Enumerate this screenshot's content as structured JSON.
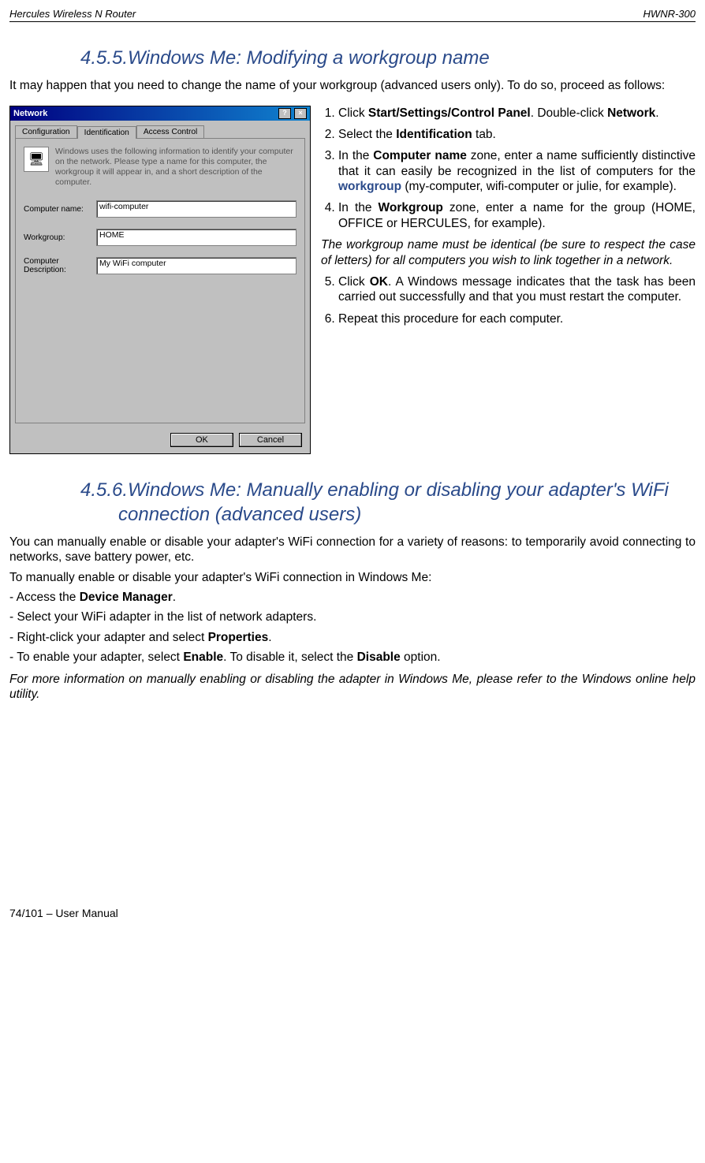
{
  "header": {
    "left": "Hercules Wireless N Router",
    "right": "HWNR-300"
  },
  "section455": {
    "heading": "4.5.5.Windows Me: Modifying a workgroup name",
    "intro": "It may happen that you need to change the name of your workgroup (advanced users only).  To do so, proceed as follows:"
  },
  "dialog": {
    "title": "Network",
    "tabs": {
      "config": "Configuration",
      "ident": "Identification",
      "access": "Access Control"
    },
    "desc": "Windows uses the following information to identify your computer on the network.  Please type a name for this computer, the workgroup it will appear in, and a short description of the computer.",
    "labels": {
      "comp_name": "Computer name:",
      "workgroup": "Workgroup:",
      "comp_desc": "Computer Description:"
    },
    "values": {
      "comp_name": "wifi-computer",
      "workgroup": "HOME",
      "comp_desc": "My WiFi computer"
    },
    "ok": "OK",
    "cancel": "Cancel",
    "help_q": "?",
    "close_x": "×"
  },
  "steps455": {
    "s1a": "Click ",
    "s1b": "Start/Settings/Control Panel",
    "s1c": ".  Double-click ",
    "s1d": "Network",
    "s1e": ".",
    "s2a": "Select the ",
    "s2b": "Identification",
    "s2c": " tab.",
    "s3a": "In the ",
    "s3b": "Computer name",
    "s3c": " zone, enter a name sufficiently distinctive that it can easily be recognized in the list of computers for the ",
    "s3d": "workgroup",
    "s3e": " (my-computer, wifi-computer or julie, for example).",
    "s4a": "In the ",
    "s4b": "Workgroup",
    "s4c": " zone, enter a name for the group (HOME, OFFICE or HERCULES, for example).",
    "note": "The workgroup name must be identical (be sure to respect the case of letters) for all computers you wish to link together in a network.",
    "s5a": "Click ",
    "s5b": "OK",
    "s5c": ".  A Windows message indicates that the task has been carried out successfully and that you must restart the computer.",
    "s6": "Repeat this procedure for each computer."
  },
  "section456": {
    "heading": "4.5.6.Windows Me:  Manually enabling or disabling your adapter's WiFi connection (advanced users)",
    "p1": "You can manually enable or disable your adapter's WiFi connection for a variety of reasons: to temporarily avoid connecting to networks, save battery power, etc.",
    "p2": "To manually enable or disable your adapter's WiFi connection in Windows Me:",
    "l1a": "- Access the ",
    "l1b": "Device Manager",
    "l1c": ".",
    "l2": "- Select your WiFi adapter in the list of network adapters.",
    "l3a": "- Right-click your adapter and select ",
    "l3b": "Properties",
    "l3c": ".",
    "l4a": "- To enable your adapter, select ",
    "l4b": "Enable",
    "l4c": ".  To disable it, select the ",
    "l4d": "Disable",
    "l4e": " option.",
    "footnote": "For more information on manually enabling or disabling the adapter in Windows Me, please refer to the Windows online help utility."
  },
  "footer": "74/101 – User Manual"
}
